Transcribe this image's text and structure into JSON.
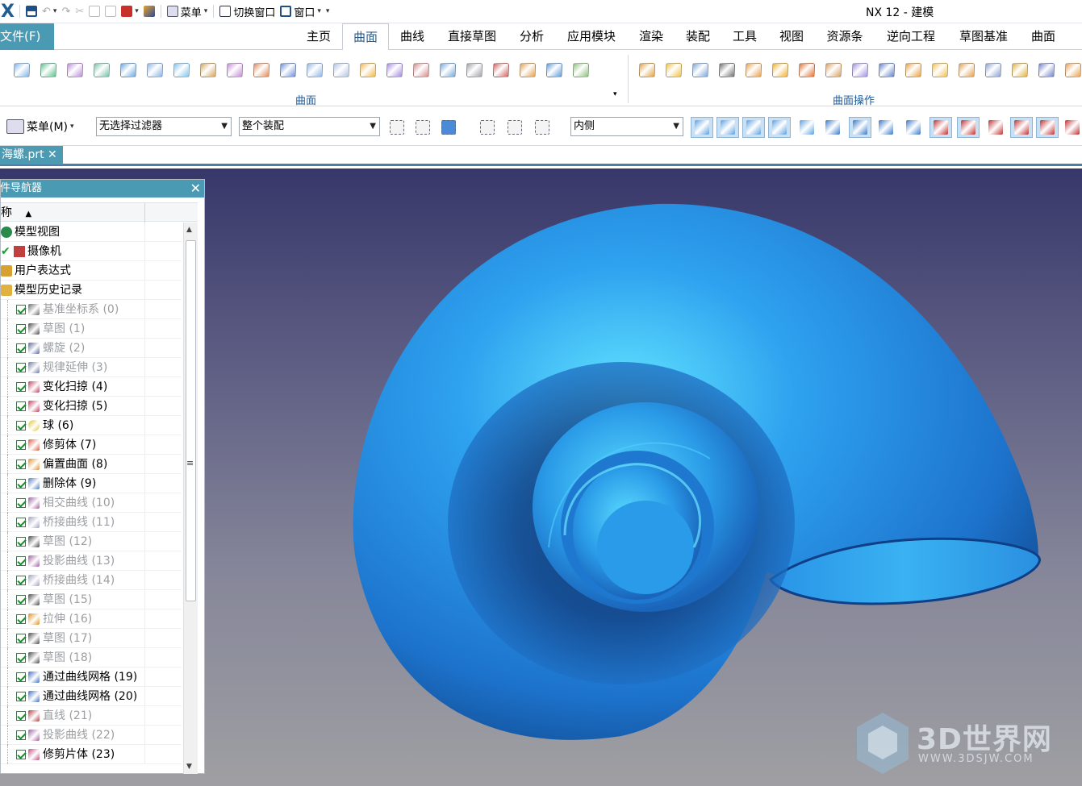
{
  "title": "NX 12 - 建模",
  "qat": {
    "menu_label": "菜单",
    "switch_window": "切换窗口",
    "window": "窗口"
  },
  "tabs": {
    "file": "文件(F)",
    "items": [
      "主页",
      "曲面",
      "曲线",
      "直接草图",
      "分析",
      "应用模块",
      "渲染",
      "装配",
      "工具",
      "视图",
      "资源条",
      "逆向工程",
      "草图基准",
      "曲面"
    ]
  },
  "ribbon": {
    "group1_label": "曲面",
    "group2_label": "曲面操作"
  },
  "selection": {
    "menu_label": "菜单(M)",
    "filter": "无选择过滤器",
    "scope": "整个装配",
    "inside": "内侧"
  },
  "document": {
    "tab": "海螺.prt"
  },
  "navigator": {
    "title": "部件导航器",
    "col_name": "名称",
    "rows": [
      {
        "label": "模型视图",
        "dim": false
      },
      {
        "label": "摄像机",
        "dim": false
      },
      {
        "label": "用户表达式",
        "dim": false
      },
      {
        "label": "模型历史记录",
        "dim": false
      },
      {
        "label": "基准坐标系 (0)",
        "dim": true
      },
      {
        "label": "草图 (1)",
        "dim": true
      },
      {
        "label": "螺旋 (2)",
        "dim": true
      },
      {
        "label": "规律延伸 (3)",
        "dim": true
      },
      {
        "label": "变化扫掠 (4)",
        "dim": false
      },
      {
        "label": "变化扫掠 (5)",
        "dim": false
      },
      {
        "label": "球 (6)",
        "dim": false
      },
      {
        "label": "修剪体 (7)",
        "dim": false
      },
      {
        "label": "偏置曲面 (8)",
        "dim": false
      },
      {
        "label": "删除体 (9)",
        "dim": false
      },
      {
        "label": "相交曲线 (10)",
        "dim": true
      },
      {
        "label": "桥接曲线 (11)",
        "dim": true
      },
      {
        "label": "草图 (12)",
        "dim": true
      },
      {
        "label": "投影曲线 (13)",
        "dim": true
      },
      {
        "label": "桥接曲线 (14)",
        "dim": true
      },
      {
        "label": "草图 (15)",
        "dim": true
      },
      {
        "label": "拉伸 (16)",
        "dim": true
      },
      {
        "label": "草图 (17)",
        "dim": true
      },
      {
        "label": "草图 (18)",
        "dim": true
      },
      {
        "label": "通过曲线网格 (19)",
        "dim": false
      },
      {
        "label": "通过曲线网格 (20)",
        "dim": false
      },
      {
        "label": "直线 (21)",
        "dim": true
      },
      {
        "label": "投影曲线 (22)",
        "dim": true
      },
      {
        "label": "修剪片体 (23)",
        "dim": false
      }
    ]
  },
  "watermark": {
    "text": "3D世界网",
    "url": "WWW.3DSJW.COM"
  },
  "colors": {
    "accent": "#4a9ab4",
    "shell": "#2f8fe6",
    "viewport_top": "#37376a",
    "viewport_bottom": "#9f9fa3"
  }
}
